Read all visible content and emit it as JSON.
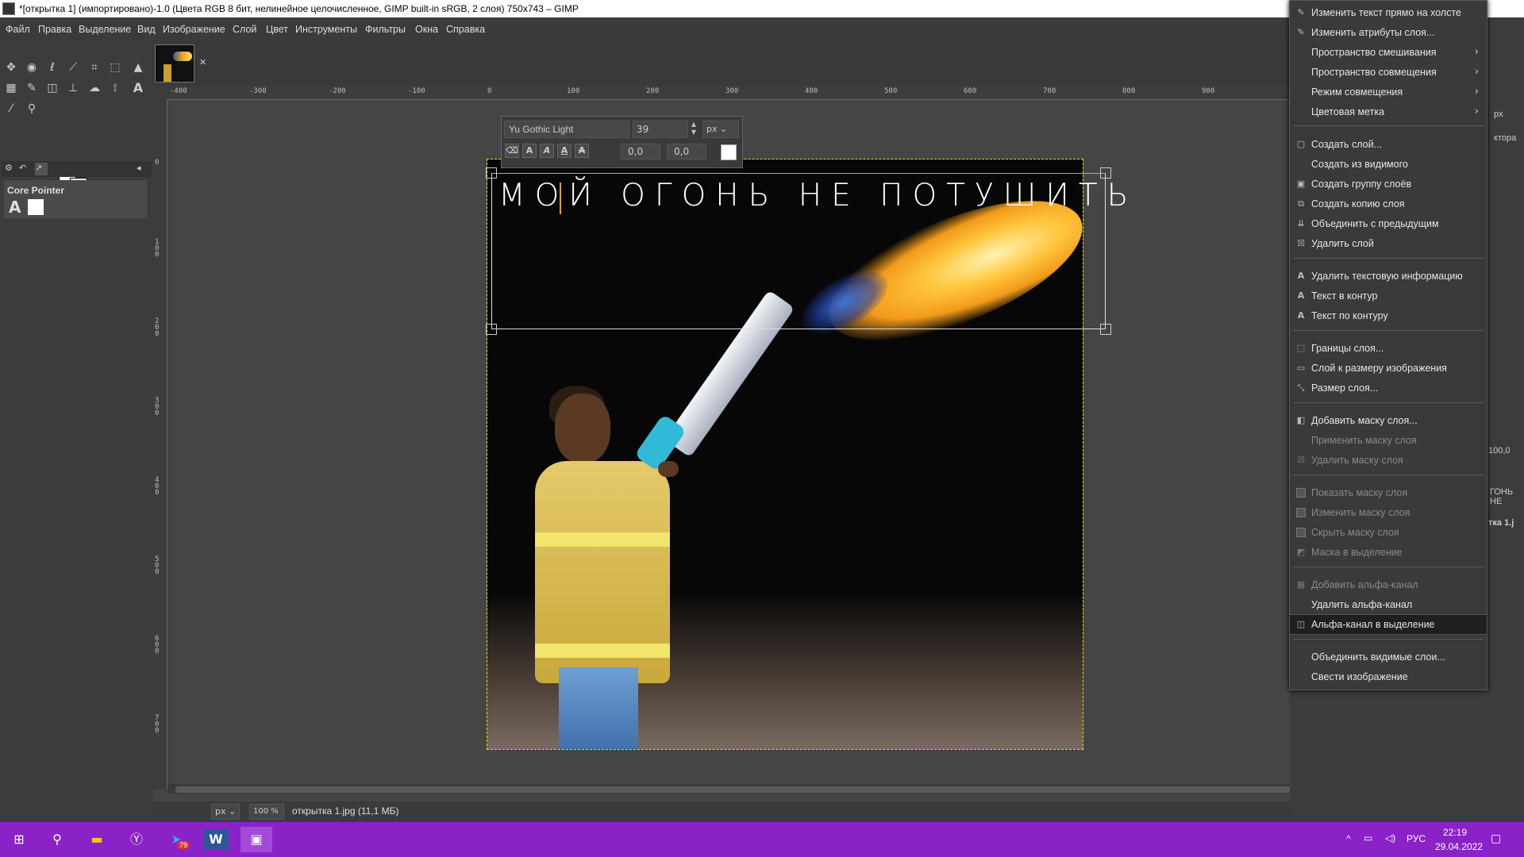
{
  "window": {
    "title": "*[открытка 1] (импортировано)-1.0 (Цвета RGB 8 бит, нелинейное целочисленное, GIMP built-in sRGB, 2 слоя) 750x743 – GIMP"
  },
  "menubar": {
    "items": [
      "Файл",
      "Правка",
      "Выделение",
      "Вид",
      "Изображение",
      "Слой",
      "Цвет",
      "Инструменты",
      "Фильтры",
      "Окна",
      "Справка"
    ]
  },
  "toolbox": {
    "device_name": "Core Pointer"
  },
  "rulers": {
    "h_labels": [
      "-400",
      "-300",
      "-200",
      "-100",
      "0",
      "100",
      "200",
      "300",
      "400",
      "500",
      "600",
      "700",
      "800",
      "900"
    ],
    "v_labels": [
      "0",
      "100",
      "200",
      "300",
      "400",
      "500",
      "600",
      "700"
    ]
  },
  "text_options": {
    "font": "Yu Gothic Light",
    "size": "39",
    "unit": "px",
    "baseline_offset": "0,0",
    "kerning": "0,0",
    "text_color": "#ffffff"
  },
  "canvas": {
    "text_layer": "МОЙ ОГОНЬ НЕ ПОТУШИТЬ"
  },
  "statusbar": {
    "unit": "px",
    "zoom": "100 %",
    "info": "открытка 1.jpg (11,1 МБ)"
  },
  "right_dock": {
    "unit": "px",
    "label_editor": "ктора",
    "opacity": "100,0",
    "layer_text": "ГОНЬ НЕ",
    "layer_image": "тка 1.j"
  },
  "context_menu": {
    "items": [
      {
        "label": "Изменить текст прямо на холсте",
        "icon": "edit-text-icon"
      },
      {
        "label": "Изменить атрибуты слоя...",
        "icon": "edit-attributes-icon"
      },
      {
        "label": "Пространство смешивания",
        "submenu": true
      },
      {
        "label": "Пространство совмещения",
        "submenu": true
      },
      {
        "label": "Режим совмещения",
        "submenu": true
      },
      {
        "label": "Цветовая метка",
        "submenu": true
      },
      {
        "label": "Создать слой...",
        "icon": "new-layer-icon"
      },
      {
        "label": "Создать из видимого"
      },
      {
        "label": "Создать группу слоёв",
        "icon": "new-group-icon"
      },
      {
        "label": "Создать копию слоя",
        "icon": "duplicate-layer-icon"
      },
      {
        "label": "Объединить с предыдущим",
        "icon": "merge-down-icon"
      },
      {
        "label": "Удалить слой",
        "icon": "delete-layer-icon"
      },
      {
        "label": "Удалить текстовую информацию",
        "icon": "text-icon"
      },
      {
        "label": "Текст в контур",
        "icon": "text-icon"
      },
      {
        "label": "Текст по контуру",
        "icon": "text-icon"
      },
      {
        "label": "Границы слоя...",
        "icon": "layer-boundary-icon"
      },
      {
        "label": "Слой к размеру изображения",
        "icon": "layer-to-image-size-icon"
      },
      {
        "label": "Размер слоя...",
        "icon": "layer-size-icon"
      },
      {
        "label": "Добавить маску слоя...",
        "icon": "add-mask-icon"
      },
      {
        "label": "Применить маску слоя",
        "disabled": true
      },
      {
        "label": "Удалить маску слоя",
        "icon": "delete-mask-icon",
        "disabled": true
      },
      {
        "label": "Показать маску слоя",
        "disabled": true,
        "checkbox": true
      },
      {
        "label": "Изменить маску слоя",
        "disabled": true,
        "checkbox": true
      },
      {
        "label": "Скрыть маску слоя",
        "disabled": true,
        "checkbox": true
      },
      {
        "label": "Маска в выделение",
        "icon": "mask-to-selection-icon",
        "disabled": true
      },
      {
        "label": "Добавить альфа-канал",
        "icon": "add-alpha-icon",
        "disabled": true
      },
      {
        "label": "Удалить альфа-канал"
      },
      {
        "label": "Альфа-канал в выделение",
        "icon": "alpha-to-selection-icon",
        "highlighted": true
      },
      {
        "label": "Объединить видимые слои..."
      },
      {
        "label": "Свести изображение"
      }
    ]
  },
  "taskbar": {
    "badge": "79",
    "lang": "РУС",
    "time": "22:19",
    "date": "29.04.2022"
  },
  "colors": {
    "taskbar": "#8a22c8",
    "selection": "#e6e600",
    "fg": "#ffffff",
    "bg": "#ffffff"
  }
}
